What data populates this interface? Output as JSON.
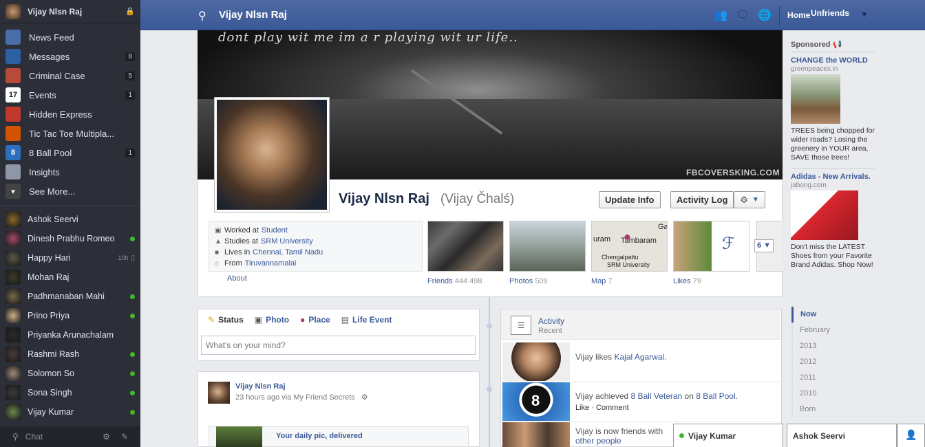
{
  "sidebar": {
    "me": "Vijay Nlsn Raj",
    "items": [
      {
        "label": "News Feed",
        "icon": "news-feed-icon",
        "badge": ""
      },
      {
        "label": "Messages",
        "icon": "messages-icon",
        "badge": "8"
      },
      {
        "label": "Criminal Case",
        "icon": "criminal-case-icon",
        "badge": "5"
      },
      {
        "label": "Events",
        "icon": "calendar-icon",
        "badge": "1",
        "icon_text": "17"
      },
      {
        "label": "Hidden Express",
        "icon": "hidden-express-icon",
        "badge": ""
      },
      {
        "label": "Tic Tac Toe Multipla...",
        "icon": "tic-tac-toe-icon",
        "badge": ""
      },
      {
        "label": "8 Ball Pool",
        "icon": "eight-ball-icon",
        "badge": "1",
        "icon_text": "8"
      },
      {
        "label": "Insights",
        "icon": "insights-icon",
        "badge": ""
      },
      {
        "label": "See More...",
        "icon": "chevron-down-icon",
        "badge": ""
      }
    ],
    "friends": [
      {
        "name": "Ashok Seervi",
        "status": ""
      },
      {
        "name": "Dinesh Prabhu Romeo",
        "status": "online"
      },
      {
        "name": "Happy Hari",
        "status": "idle",
        "idle": "10h"
      },
      {
        "name": "Mohan Raj",
        "status": ""
      },
      {
        "name": "Padhmanaban Mahi",
        "status": "online"
      },
      {
        "name": "Prino Priya",
        "status": "online"
      },
      {
        "name": "Priyanka Arunachalam",
        "status": ""
      },
      {
        "name": "Rashmi Rash",
        "status": "online"
      },
      {
        "name": "Solomon So",
        "status": "online"
      },
      {
        "name": "Sona Singh",
        "status": "online"
      },
      {
        "name": "Vijay Kumar",
        "status": "online"
      }
    ],
    "chat_label": "Chat"
  },
  "topbar": {
    "title": "Vijay Nlsn Raj",
    "home": "Home",
    "unfriends": "Unfriends"
  },
  "cover": {
    "tagline": "dont play wit me im a r playing wit ur life..",
    "watermark": "FBCOVERSKING.COM"
  },
  "profile": {
    "name": "Vijay Nlsn Raj",
    "alt_name": "(Vijay Čhalś)",
    "update_info": "Update Info",
    "activity_log": "Activity Log",
    "info": [
      {
        "prefix": "Worked at",
        "link": "Student",
        "icon": "briefcase-icon"
      },
      {
        "prefix": "Studies at",
        "link": "SRM University",
        "icon": "graduation-cap-icon"
      },
      {
        "prefix": "Lives in",
        "link": "Chennai, Tamil Nadu",
        "icon": "house-icon"
      },
      {
        "prefix": "From",
        "link": "Tiruvannamalai",
        "icon": "home-icon"
      }
    ],
    "about": "About",
    "thumbs": [
      {
        "label": "Friends",
        "count": "444 498"
      },
      {
        "label": "Photos",
        "count": "509"
      },
      {
        "label": "Map",
        "count": "7"
      },
      {
        "label": "Likes",
        "count": "79"
      }
    ],
    "map_labels": [
      "uram",
      "Tambaram",
      "Chengalpattu",
      "SRM University",
      "Ga"
    ],
    "more": "6"
  },
  "composer": {
    "tabs": [
      "Status",
      "Photo",
      "Place",
      "Life Event"
    ],
    "placeholder": "What's on your mind?"
  },
  "post": {
    "author": "Vijay Nlsn Raj",
    "meta": "23 hours ago via My Friend Secrets",
    "link_title": "Your daily pic, delivered"
  },
  "activity": {
    "title": "Activity",
    "subtitle": "Recent",
    "rows": [
      {
        "text": "Vijay likes ",
        "link": "Kajal Agarwal",
        "tail": ".",
        "actions": ""
      },
      {
        "text": "Vijay achieved ",
        "link": "8 Ball Veteran",
        "tail": " on ",
        "link2": "8 Ball Pool",
        "tail2": ".",
        "actions": "Like · Comment"
      },
      {
        "text": "Vijay is now friends with ",
        "link": "other people",
        "tail": "",
        "actions": ""
      }
    ]
  },
  "ads": {
    "sponsored": "Sponsored",
    "items": [
      {
        "title": "CHANGE the WORLD",
        "domain": "greenpeacex.in",
        "body": "TREES being chopped for wider roads? Losing the greenery in YOUR area, SAVE those trees!"
      },
      {
        "title": "Adidas - New Arrivals.",
        "domain": "jabong.com",
        "body": "Don't miss the LATEST Shoes from your Favorite Brand Adidas. Shop Now!"
      }
    ]
  },
  "years": [
    "Now",
    "February",
    "2013",
    "2012",
    "2011",
    "2010",
    "Born"
  ],
  "chat_tabs": [
    "Vijay Kumar",
    "Ashok Seervi"
  ],
  "colors": {
    "brand": "#3b5998",
    "sidebar": "#2c2f38",
    "online": "#42b72a"
  }
}
